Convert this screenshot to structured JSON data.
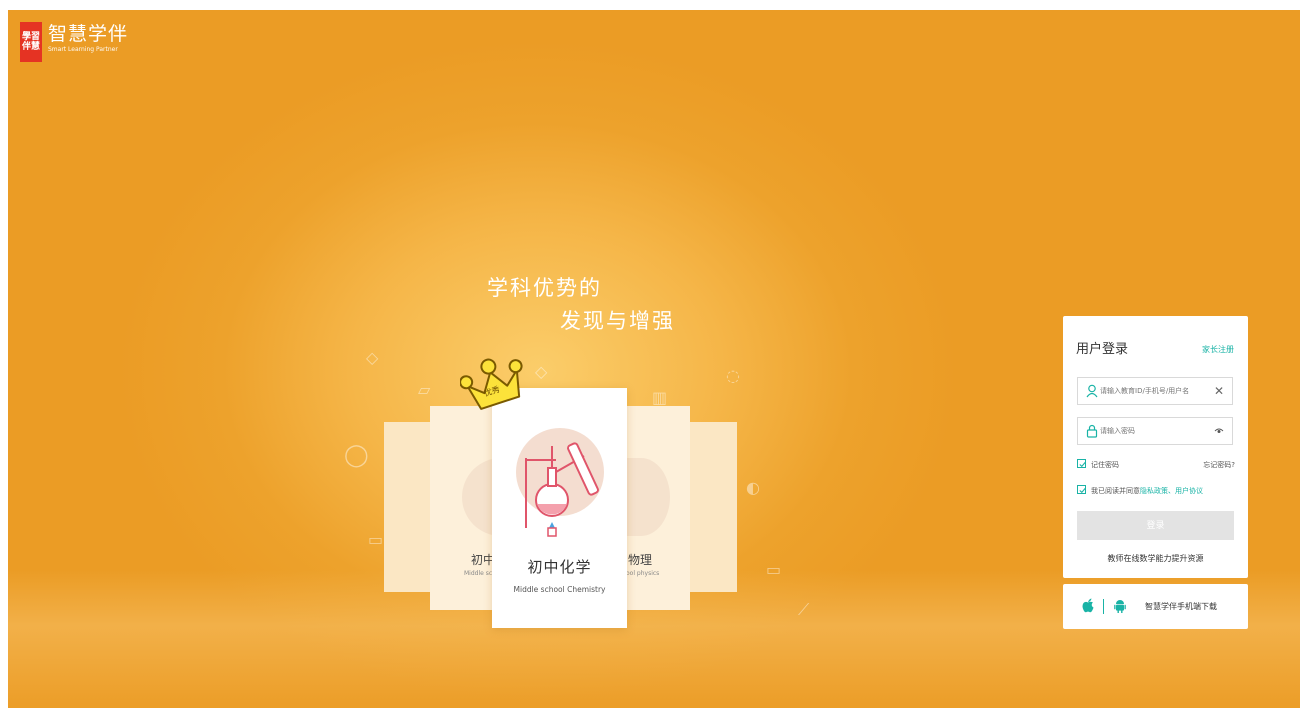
{
  "brand": {
    "logo_mark": [
      "學習",
      "伴慧"
    ],
    "name_cn": "智慧学伴",
    "name_en": "Smart Learning Partner"
  },
  "hero": {
    "slogan_line1": "学科优势的",
    "slogan_line2": "发现与增强",
    "badge": "优秀",
    "cards": {
      "left_title": "初中",
      "left_sub": "Middle scho",
      "right_title": "物理",
      "right_sub": "ool physics",
      "main_title": "初中化学",
      "main_sub": "Middle school Chemistry"
    }
  },
  "login": {
    "title": "用户登录",
    "register_link": "家长注册",
    "account_placeholder": "请输入教育ID/手机号/用户名",
    "password_placeholder": "请输入密码",
    "remember_label": "记住密码",
    "forgot_link": "忘记密码?",
    "agree_prefix": "我已阅读并同意",
    "privacy_link": "隐私政策、",
    "terms_link": "用户协议",
    "submit_label": "登录",
    "teacher_link": "教师在线数学能力提升资源"
  },
  "download": {
    "label": "智慧学伴手机端下载"
  },
  "colors": {
    "accent": "#19b3a6",
    "background": "#eda22c",
    "logo_red": "#e53323"
  }
}
